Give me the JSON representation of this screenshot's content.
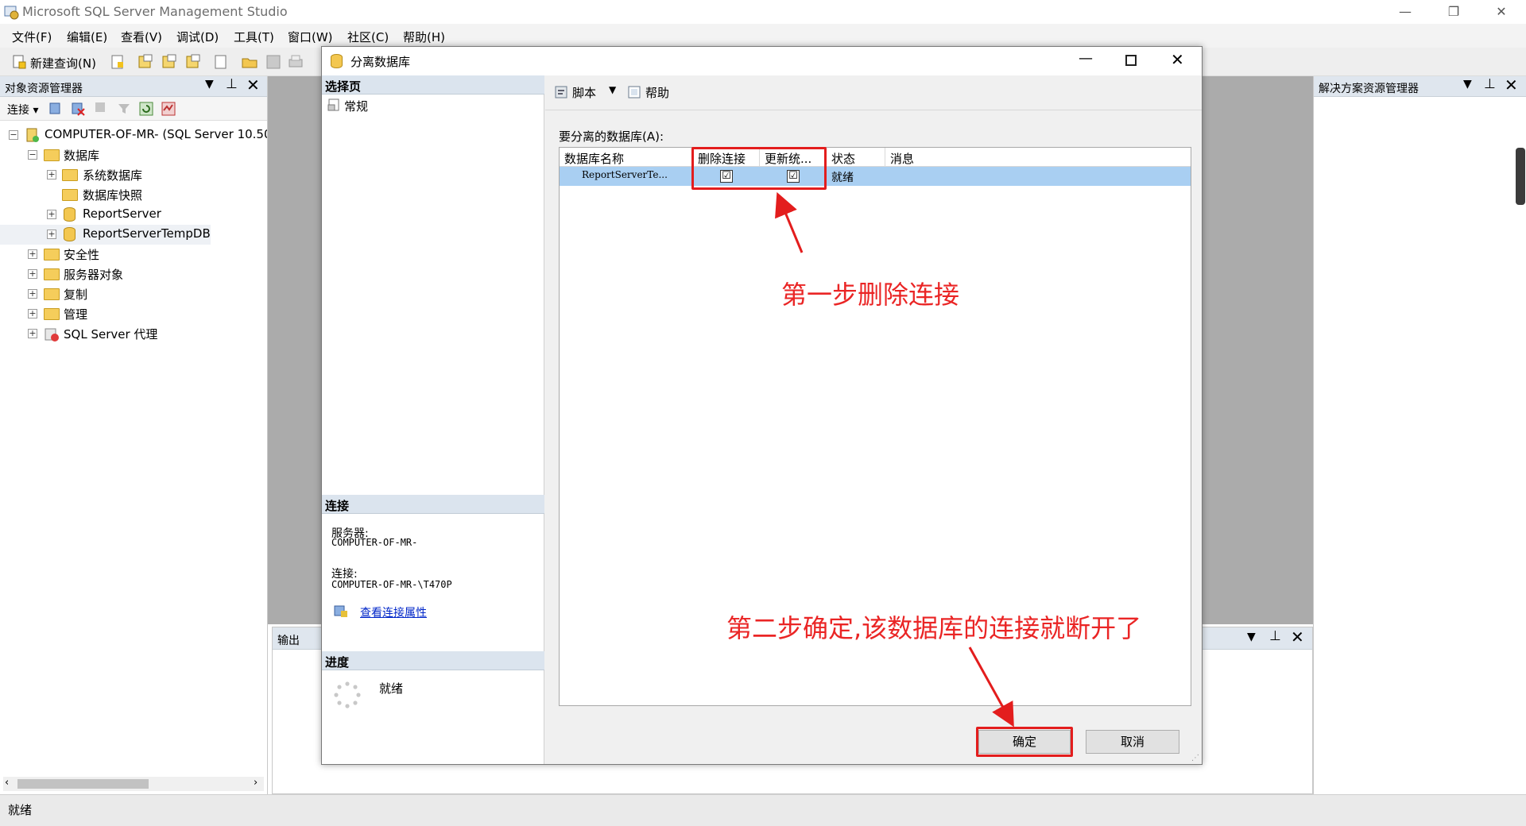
{
  "window": {
    "title": "Microsoft SQL Server Management Studio"
  },
  "menu": [
    "文件(F)",
    "编辑(E)",
    "查看(V)",
    "调试(D)",
    "工具(T)",
    "窗口(W)",
    "社区(C)",
    "帮助(H)"
  ],
  "toolbar": {
    "new_query": "新建查询(N)"
  },
  "object_explorer": {
    "title": "对象资源管理器",
    "connect_label": "连接",
    "tree": [
      {
        "label": "COMPUTER-OF-MR- (SQL Server 10.50",
        "level": 0,
        "expander": "−"
      },
      {
        "label": "数据库",
        "level": 1,
        "expander": "−"
      },
      {
        "label": "系统数据库",
        "level": 2,
        "expander": "+"
      },
      {
        "label": "数据库快照",
        "level": 2,
        "expander": ""
      },
      {
        "label": "ReportServer",
        "level": 2,
        "expander": "+"
      },
      {
        "label": "ReportServerTempDB",
        "level": 2,
        "expander": "+"
      },
      {
        "label": "安全性",
        "level": 1,
        "expander": "+"
      },
      {
        "label": "服务器对象",
        "level": 1,
        "expander": "+"
      },
      {
        "label": "复制",
        "level": 1,
        "expander": "+"
      },
      {
        "label": "管理",
        "level": 1,
        "expander": "+"
      },
      {
        "label": "SQL Server 代理",
        "level": 1,
        "expander": "+"
      }
    ]
  },
  "solution_explorer": {
    "title": "解决方案资源管理器"
  },
  "output": {
    "title": "输出"
  },
  "status": {
    "text": "就绪"
  },
  "dialog": {
    "title": "分离数据库",
    "select_page_head": "选择页",
    "page_general": "常规",
    "script_label": "脚本",
    "help_label": "帮助",
    "db_list_label": "要分离的数据库(A):",
    "columns": {
      "name": "数据库名称",
      "drop": "删除连接",
      "update": "更新统...",
      "state": "状态",
      "message": "消息"
    },
    "row": {
      "name": "ReportServerTe...",
      "drop_checked": "☑",
      "update_checked": "☑",
      "state": "就绪",
      "message": ""
    },
    "connection_head": "连接",
    "server_label": "服务器:",
    "server_value": "COMPUTER-OF-MR-",
    "conn_label": "连接:",
    "conn_value": "COMPUTER-OF-MR-\\T470P",
    "view_conn_props": "查看连接属性",
    "progress_head": "进度",
    "progress_status": "就绪",
    "ok_label": "确定",
    "cancel_label": "取消"
  },
  "annotations": {
    "step1": "第一步删除连接",
    "step2": "第二步确定,该数据库的连接就断开了"
  },
  "colors": {
    "annotation_red": "#e31d1d",
    "selected_row": "#a9cff2",
    "link_blue": "#0026c9"
  }
}
